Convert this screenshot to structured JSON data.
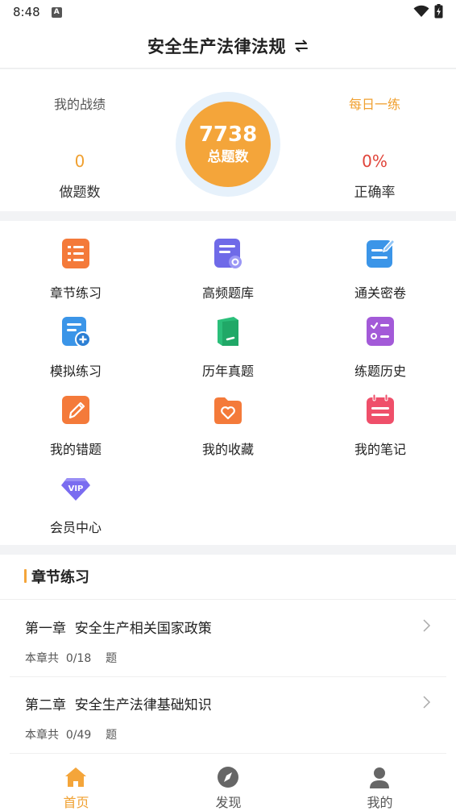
{
  "status_bar": {
    "time": "8:48",
    "notification_icon": "a-icon"
  },
  "header": {
    "title": "安全生产法律法规",
    "switch_icon": "switch-arrows-icon"
  },
  "stats": {
    "my_record_label": "我的战绩",
    "daily_practice_label": "每日一练",
    "total_number": "7738",
    "total_label": "总题数",
    "done_value": "0",
    "done_label": "做题数",
    "accuracy_value": "0%",
    "accuracy_label": "正确率"
  },
  "grid": [
    {
      "label": "章节练习",
      "icon": "list-doc-icon"
    },
    {
      "label": "高频题库",
      "icon": "doc-settings-icon"
    },
    {
      "label": "通关密卷",
      "icon": "doc-edit-icon"
    },
    {
      "label": "模拟练习",
      "icon": "doc-plus-icon"
    },
    {
      "label": "历年真题",
      "icon": "book-icon"
    },
    {
      "label": "练题历史",
      "icon": "checklist-icon"
    },
    {
      "label": "我的错题",
      "icon": "pencil-icon"
    },
    {
      "label": "我的收藏",
      "icon": "folder-heart-icon"
    },
    {
      "label": "我的笔记",
      "icon": "notebook-icon"
    },
    {
      "label": "会员中心",
      "icon": "vip-icon"
    }
  ],
  "chapters": {
    "section_title": "章节练习",
    "items": [
      {
        "name": "第一章  安全生产相关国家政策",
        "meta": "本章共  0/18    题"
      },
      {
        "name": "第二章  安全生产法律基础知识",
        "meta": "本章共  0/49    题"
      }
    ]
  },
  "nav": [
    {
      "label": "首页",
      "icon": "home-icon",
      "active": true
    },
    {
      "label": "发现",
      "icon": "compass-icon",
      "active": false
    },
    {
      "label": "我的",
      "icon": "person-icon",
      "active": false
    }
  ],
  "colors": {
    "accent": "#f4a53a",
    "orange_text": "#f0a030",
    "red_text": "#e0443a"
  }
}
